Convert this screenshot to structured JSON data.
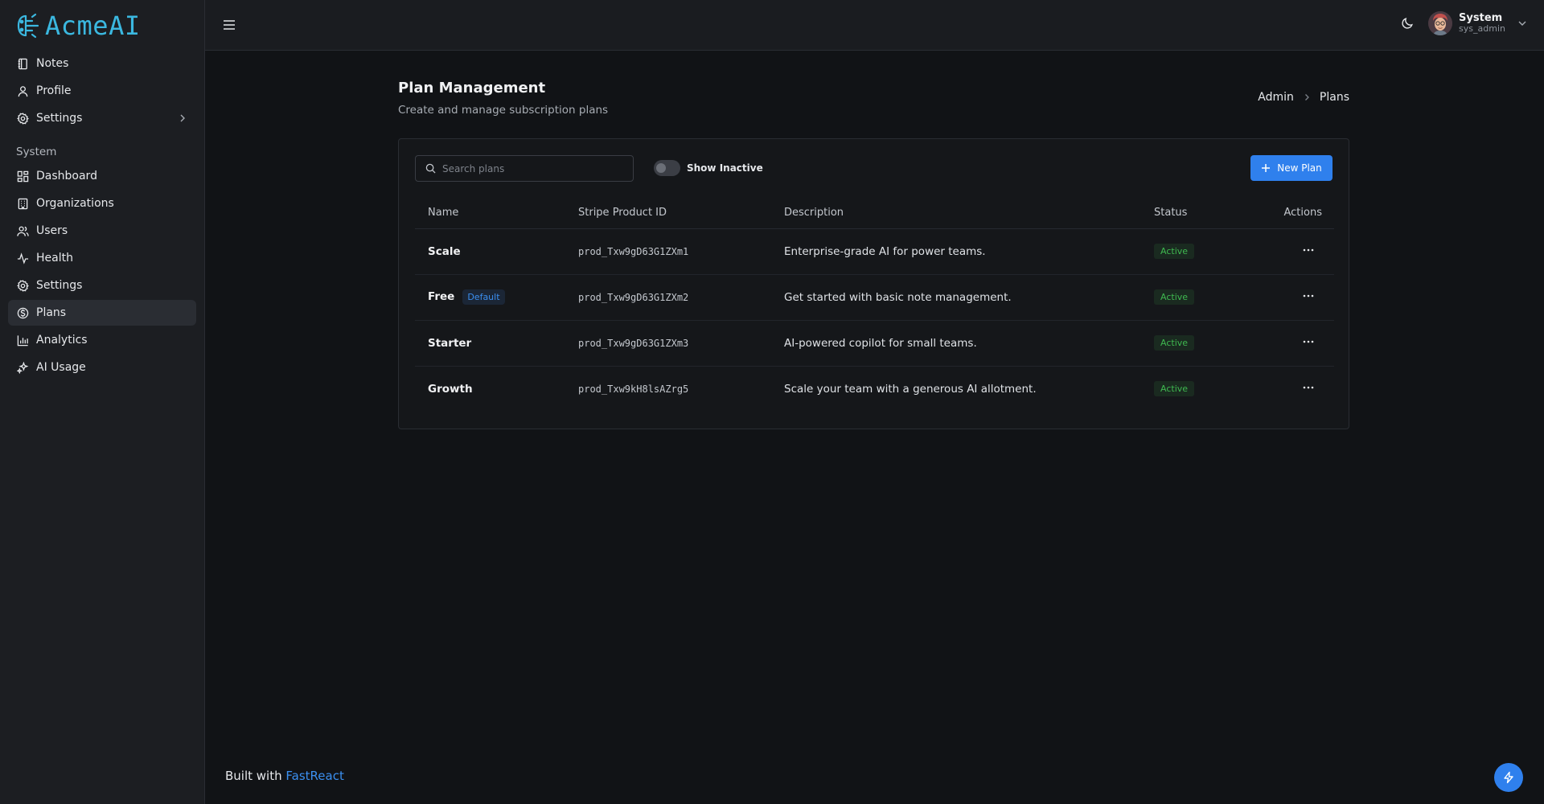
{
  "app": {
    "name": "AcmeAI"
  },
  "sidebar": {
    "items": [
      {
        "label": "Notes",
        "icon": "notebook-icon"
      },
      {
        "label": "Profile",
        "icon": "user-icon"
      },
      {
        "label": "Settings",
        "icon": "gear-icon"
      }
    ],
    "section_title": "System",
    "system_items": [
      {
        "label": "Dashboard",
        "icon": "dashboard-icon"
      },
      {
        "label": "Organizations",
        "icon": "building-icon"
      },
      {
        "label": "Users",
        "icon": "users-icon"
      },
      {
        "label": "Health",
        "icon": "activity-icon"
      },
      {
        "label": "Settings",
        "icon": "gear-icon"
      },
      {
        "label": "Plans",
        "icon": "dollar-circle-icon",
        "active": true
      },
      {
        "label": "Analytics",
        "icon": "bar-chart-icon"
      },
      {
        "label": "AI Usage",
        "icon": "sparkles-icon"
      }
    ],
    "footer": {
      "prefix": "Built with",
      "link": "FastReact"
    }
  },
  "topbar": {
    "user": {
      "name": "System",
      "handle": "sys_admin"
    }
  },
  "page": {
    "title": "Plan Management",
    "subtitle": "Create and manage subscription plans",
    "breadcrumb": [
      "Admin",
      "Plans"
    ]
  },
  "toolbar": {
    "search_placeholder": "Search plans",
    "toggle_label": "Show Inactive",
    "toggle_on": false,
    "new_button": "New Plan"
  },
  "table": {
    "headers": [
      "Name",
      "Stripe Product ID",
      "Description",
      "Status",
      "Actions"
    ],
    "rows": [
      {
        "name": "Scale",
        "badge": "",
        "product_id": "prod_Txw9gD63G1ZXm1",
        "description": "Enterprise-grade AI for power teams.",
        "status": "Active"
      },
      {
        "name": "Free",
        "badge": "Default",
        "product_id": "prod_Txw9gD63G1ZXm2",
        "description": "Get started with basic note management.",
        "status": "Active"
      },
      {
        "name": "Starter",
        "badge": "",
        "product_id": "prod_Txw9gD63G1ZXm3",
        "description": "AI-powered copilot for small teams.",
        "status": "Active"
      },
      {
        "name": "Growth",
        "badge": "",
        "product_id": "prod_Txw9kH8lsAZrg5",
        "description": "Scale your team with a generous AI allotment.",
        "status": "Active"
      }
    ]
  },
  "colors": {
    "accent": "#2f80ed",
    "active": "#3fb950",
    "logo": "#3bb8e0"
  }
}
